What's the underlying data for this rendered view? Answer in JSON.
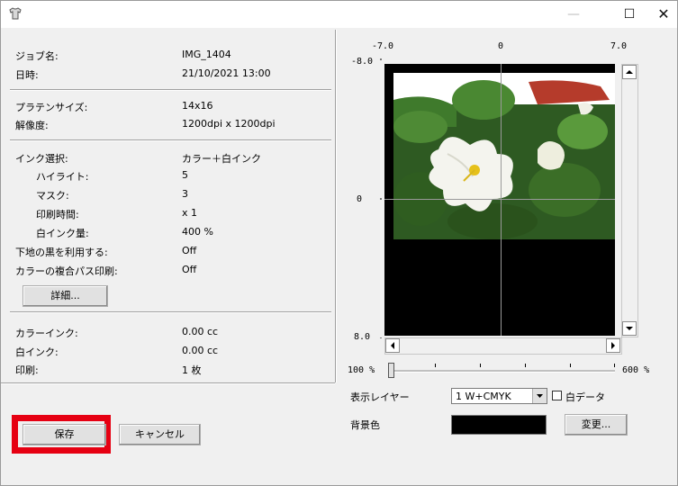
{
  "window": {
    "minimize": "—",
    "maximize": "☐",
    "close": "✕"
  },
  "job": {
    "job_name_label": "ジョブ名:",
    "job_name": "IMG_1404",
    "datetime_label": "日時:",
    "datetime": "21/10/2021 13:00"
  },
  "platen": {
    "size_label": "プラテンサイズ:",
    "size": "14x16",
    "resolution_label": "解像度:",
    "resolution": "1200dpi x 1200dpi"
  },
  "ink": {
    "selection_label": "インク選択:",
    "selection": "カラー＋白インク",
    "highlight_label": "ハイライト:",
    "highlight": "5",
    "mask_label": "マスク:",
    "mask": "3",
    "print_time_label": "印刷時間:",
    "print_time": "x 1",
    "white_amount_label": "白インク量:",
    "white_amount": "400 %",
    "use_black_label": "下地の黒を利用する:",
    "use_black": "Off",
    "multipass_label": "カラーの複合パス印刷:",
    "multipass": "Off",
    "details_button": "詳細..."
  },
  "usage": {
    "color_ink_label": "カラーインク:",
    "color_ink": "0.00 cc",
    "white_ink_label": "白インク:",
    "white_ink": "0.00 cc",
    "print_label": "印刷:",
    "print": "1 枚"
  },
  "buttons": {
    "save": "保存",
    "cancel": "キャンセル"
  },
  "preview": {
    "x_ticks": [
      "-7.0",
      "0",
      "7.0"
    ],
    "y_ticks": [
      "-8.0",
      "0",
      "8.0"
    ]
  },
  "zoom": {
    "min": "100 %",
    "max": "600 %",
    "level_fraction": 0
  },
  "layer": {
    "label": "表示レイヤー",
    "selected": "1  W+CMYK",
    "white_data_label": "白データ"
  },
  "background": {
    "label": "背景色",
    "color": "#000000",
    "change_button": "変更..."
  },
  "colors": {
    "highlight": "#e60012",
    "face": "#f0f0f0"
  }
}
